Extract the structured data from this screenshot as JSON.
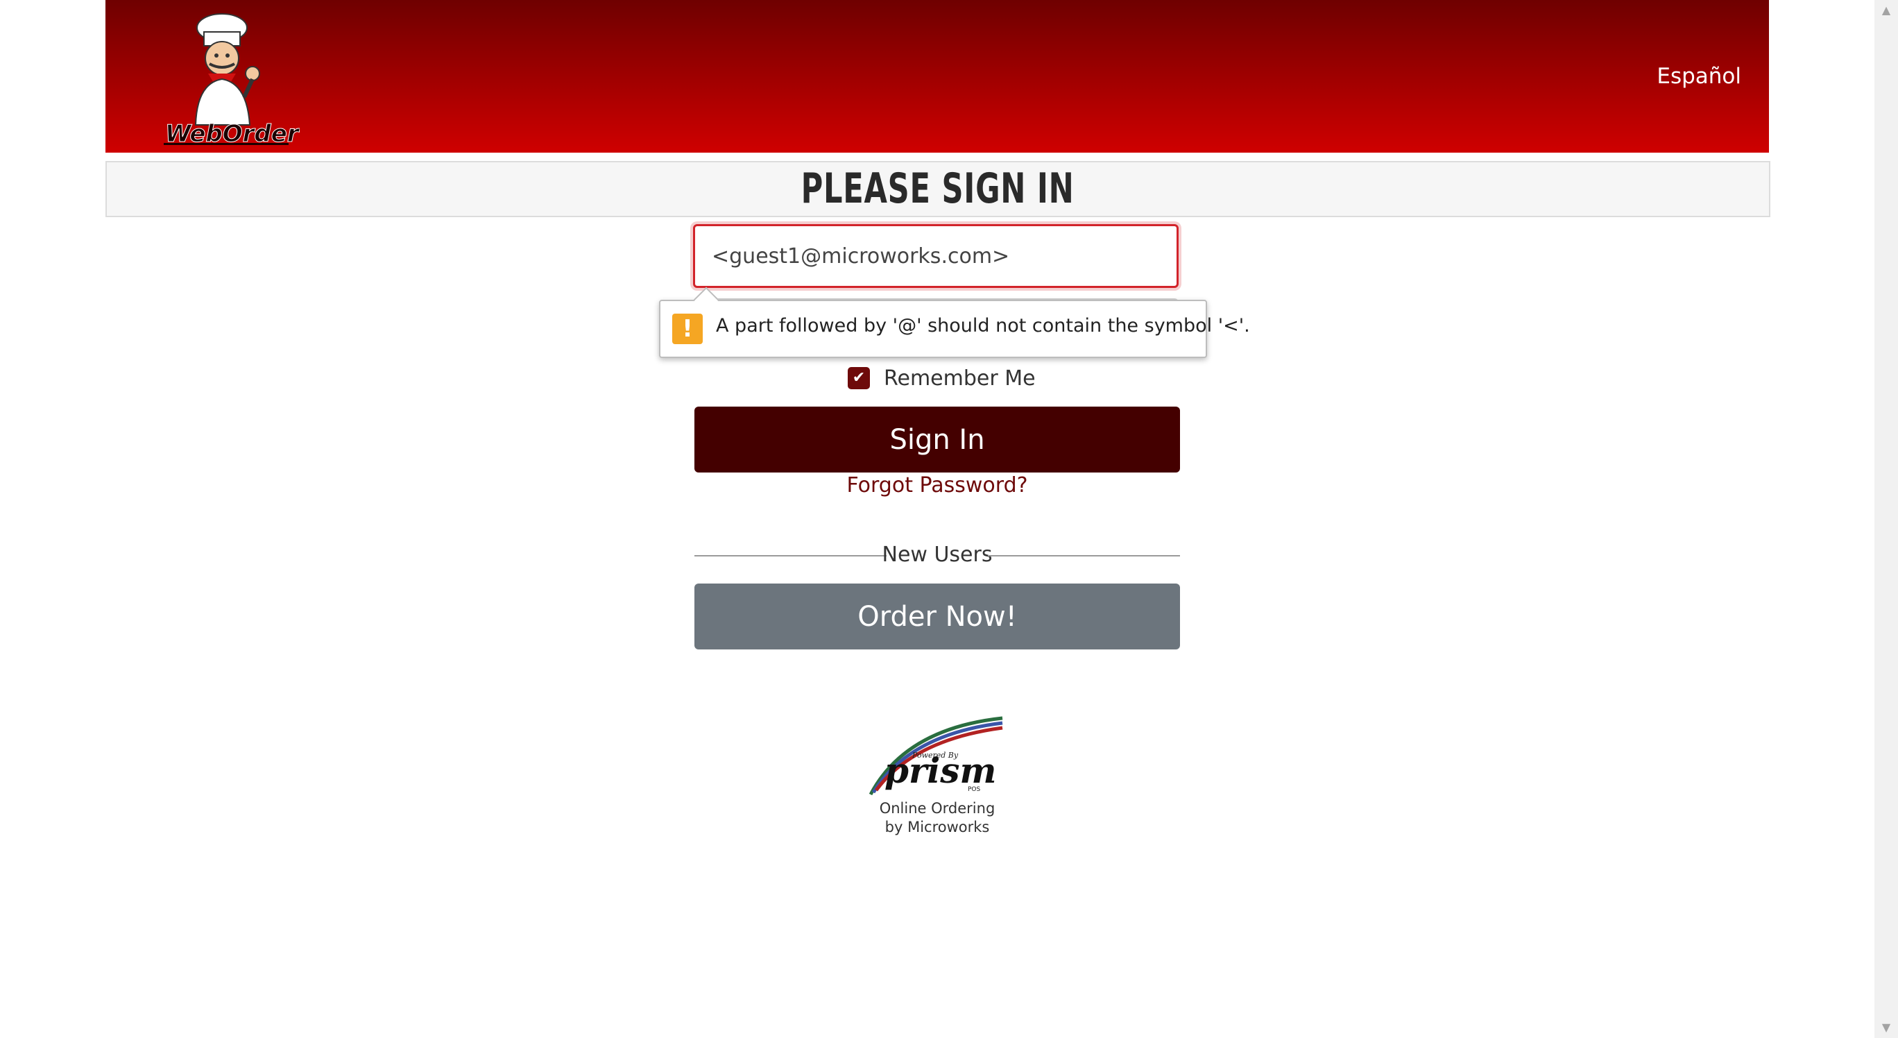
{
  "header": {
    "logo_text": "WebOrder",
    "language_link": "Español",
    "colors": {
      "header_top": "#6f0000",
      "header_bottom": "#cf0000"
    }
  },
  "page": {
    "title": "Please Sign In"
  },
  "form": {
    "email_value": "<guest1@microworks.com>",
    "validation_message": "A part followed by '@' should not contain the symbol '<'.",
    "remember_me_label": "Remember Me",
    "remember_me_checked": true,
    "sign_in_label": "Sign In",
    "forgot_password_label": "Forgot Password?",
    "new_users_label": "New Users",
    "order_now_label": "Order Now!"
  },
  "footer": {
    "logo_caption_small": "Powered By",
    "logo_text": "prism",
    "logo_suffix": "POS",
    "line1": "Online Ordering",
    "line2": "by Microworks"
  },
  "colors": {
    "accent_dark": "#440000",
    "link": "#6e0a0a",
    "secondary_button": "#6c757d",
    "error_border": "#d2232a",
    "warning": "#f5a623"
  }
}
